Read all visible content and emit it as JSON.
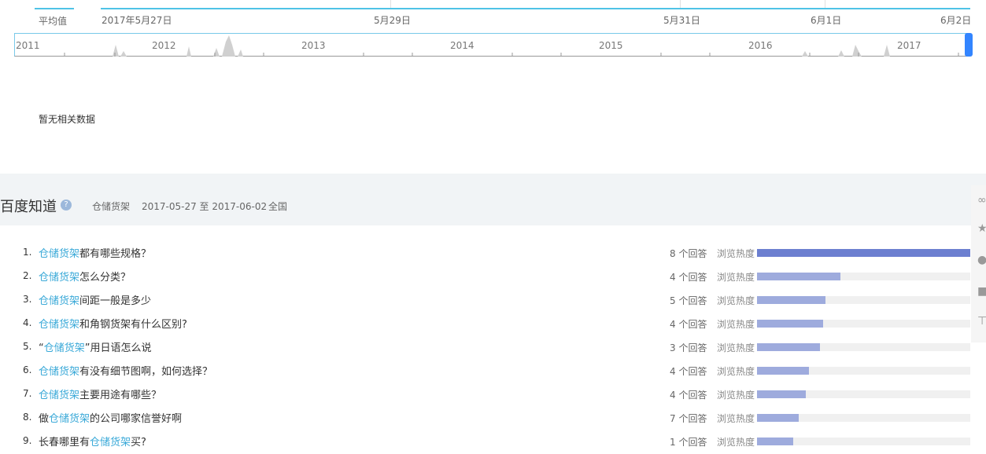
{
  "trend": {
    "tab_label": "平均值",
    "dates": [
      "2017年5月27日",
      "5月29日",
      "5月31日",
      "6月1日",
      "6月2日"
    ],
    "years": [
      "2011",
      "2012",
      "2013",
      "2014",
      "2015",
      "2016",
      "2017"
    ],
    "no_data": "暂无相关数据"
  },
  "zhidao": {
    "title": "百度知道",
    "help_icon": "question-icon",
    "keyword": "仓储货架",
    "date_range": "2017-05-27 至 2017-06-02",
    "region": "全国",
    "heat_label": "浏览热度",
    "items": [
      {
        "num": "1.",
        "pre": "",
        "kw": "仓储货架",
        "post": "都有哪些规格？",
        "answers": "8 个回答",
        "heat": 1.0
      },
      {
        "num": "2.",
        "pre": "",
        "kw": "仓储货架",
        "post": "怎么分类？",
        "answers": "4 个回答",
        "heat": 0.39
      },
      {
        "num": "3.",
        "pre": "",
        "kw": "仓储货架",
        "post": "间距一般是多少",
        "answers": "5 个回答",
        "heat": 0.32
      },
      {
        "num": "4.",
        "pre": "",
        "kw": "仓储货架",
        "post": "和角钢货架有什么区别?",
        "answers": "4 个回答",
        "heat": 0.31
      },
      {
        "num": "5.",
        "pre": "“",
        "kw": "仓储货架",
        "post": "”用日语怎么说",
        "answers": "3 个回答",
        "heat": 0.295
      },
      {
        "num": "6.",
        "pre": "",
        "kw": "仓储货架",
        "post": "有没有细节图啊，如何选择？",
        "answers": "4 个回答",
        "heat": 0.245
      },
      {
        "num": "7.",
        "pre": "",
        "kw": "仓储货架",
        "post": "主要用途有哪些？",
        "answers": "4 个回答",
        "heat": 0.23
      },
      {
        "num": "8.",
        "pre": "做",
        "kw": "仓储货架",
        "post": "的公司哪家信誉好啊",
        "answers": "7 个回答",
        "heat": 0.195
      },
      {
        "num": "9.",
        "pre": "长春哪里有",
        "kw": "仓储货架",
        "post": "买?",
        "answers": "1 个回答",
        "heat": 0.17
      }
    ]
  },
  "side": {
    "icons": [
      "share-icon",
      "star-icon",
      "help-icon",
      "feedback-icon",
      "top-icon"
    ]
  },
  "colors": {
    "accent": "#4fc3e6",
    "keyword": "#3aa9d8",
    "bar_top": "#6c7fd0",
    "bar": "#9eabdd"
  }
}
